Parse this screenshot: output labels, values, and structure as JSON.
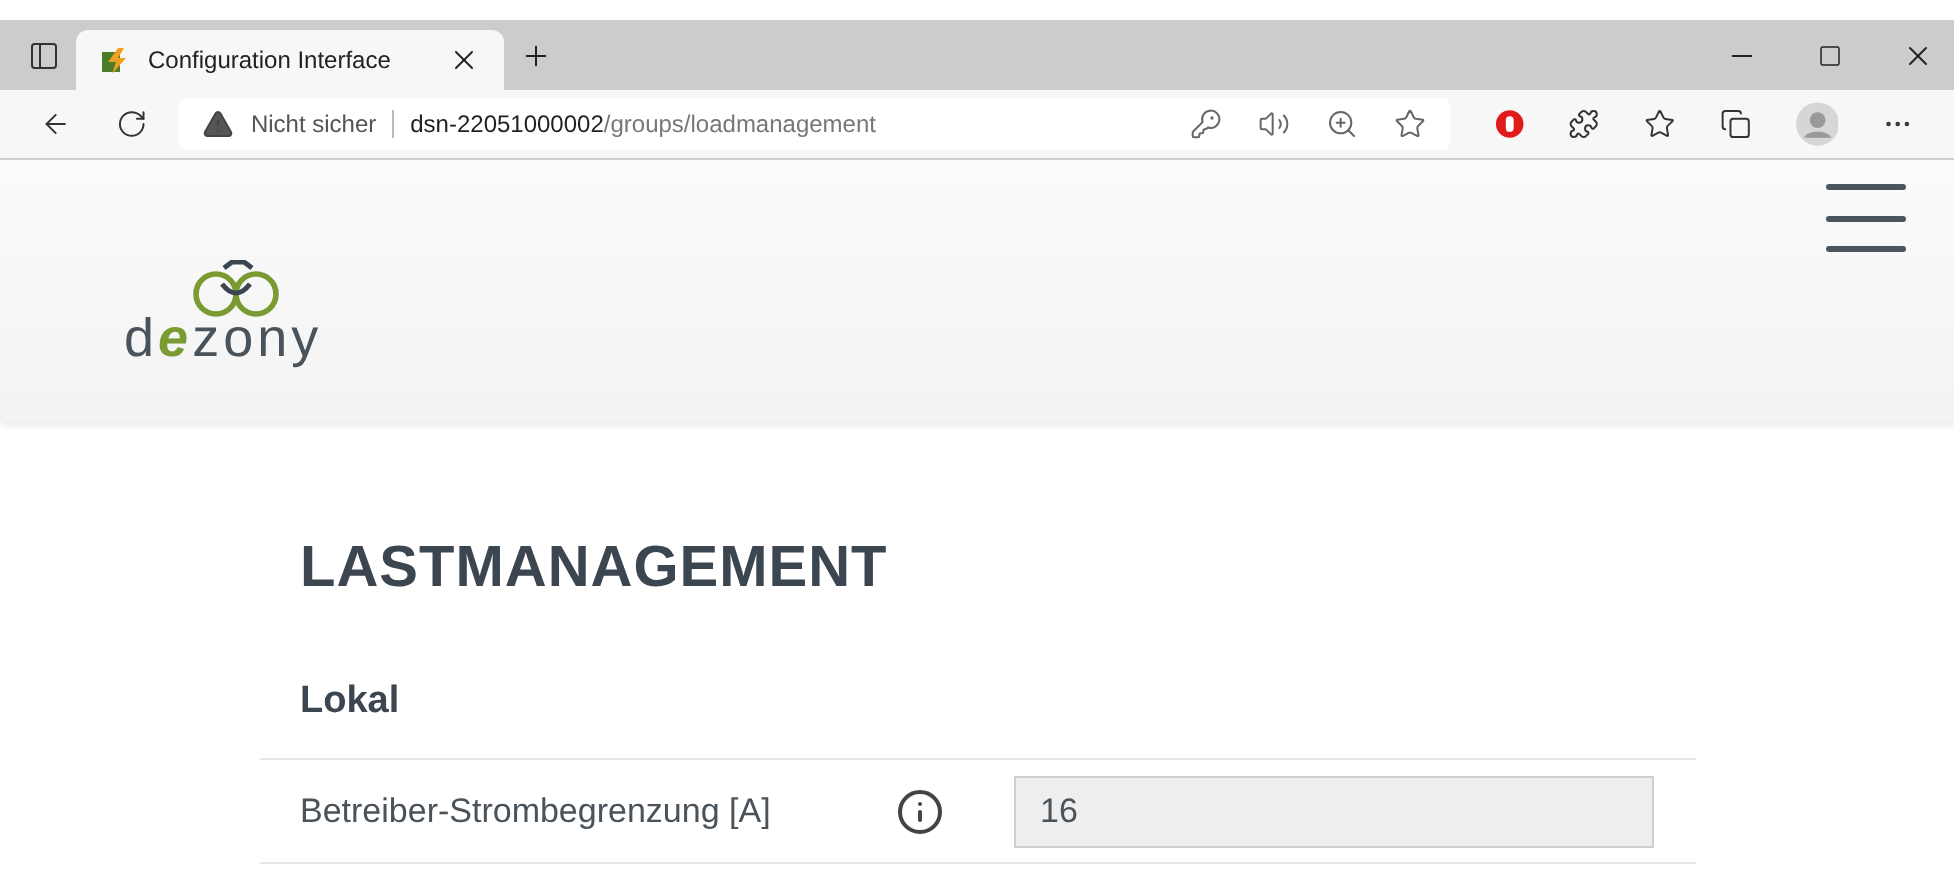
{
  "browser": {
    "tab": {
      "title": "Configuration Interface",
      "selected": true
    },
    "address": {
      "security": "Nicht sicher",
      "host": "dsn-22051000002",
      "path": "/groups/loadmanagement"
    }
  },
  "logo": {
    "lead": "d",
    "accent": "e",
    "rest": "zony"
  },
  "page": {
    "title": "LASTMANAGEMENT",
    "section": "Lokal",
    "fields": [
      {
        "label": "Betreiber-Strombegrenzung [A]",
        "value": "16",
        "disabled": true
      }
    ]
  }
}
